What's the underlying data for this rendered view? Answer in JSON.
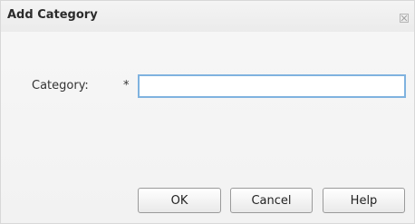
{
  "dialog": {
    "title": "Add Category",
    "close_icon": "close-icon"
  },
  "form": {
    "category_label": "Category:",
    "required_marker": "*",
    "category_value": "",
    "category_placeholder": ""
  },
  "buttons": {
    "ok": "OK",
    "cancel": "Cancel",
    "help": "Help"
  },
  "colors": {
    "input_focus_border": "#7fb2df"
  }
}
